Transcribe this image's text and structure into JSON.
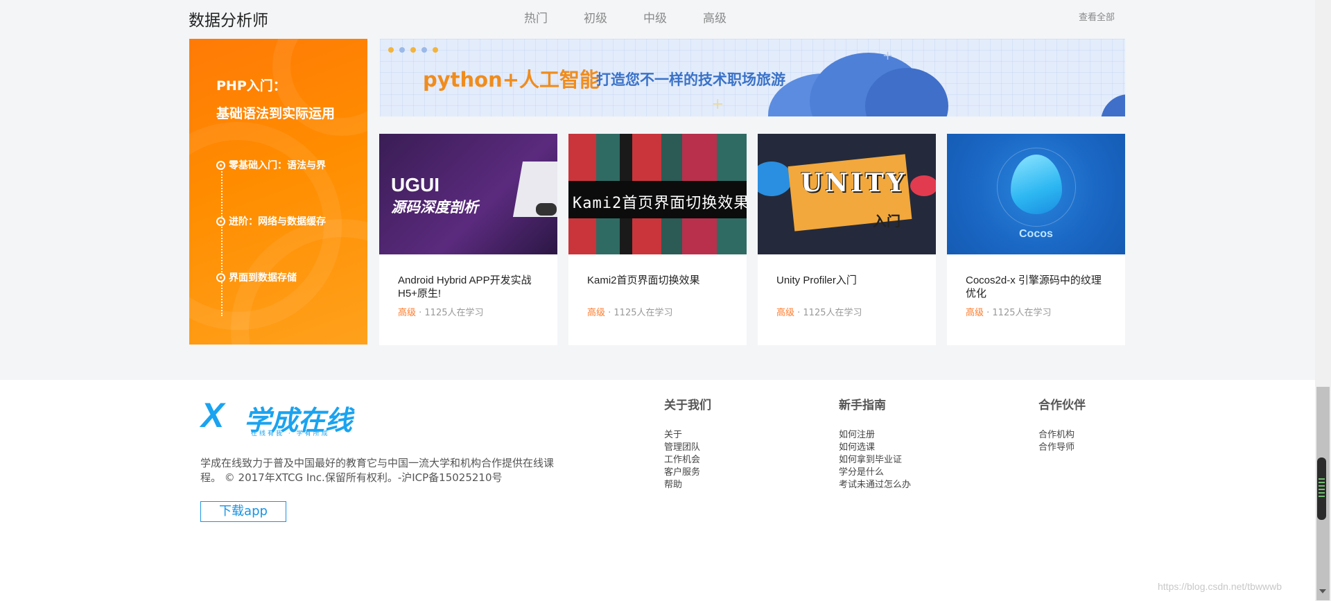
{
  "section": {
    "title": "数据分析师",
    "tabs": [
      "热门",
      "初级",
      "中级",
      "高级"
    ],
    "view_all": "查看全部"
  },
  "promo": {
    "title_line1": "PHP入门：",
    "title_line2": "基础语法到实际运用",
    "items": [
      "零基础入门：语法与界",
      "进阶：网络与数据缓存",
      "界面到数据存储"
    ]
  },
  "banner": {
    "main": "python+人工智能",
    "sub": "打造您不一样的技术职场旅游"
  },
  "courses": [
    {
      "thumb_line1": "UGUI",
      "thumb_line2": "源码深度剖析",
      "name": "Android Hybrid APP开发实战 H5+原生!",
      "level": "高级",
      "learners": " · 1125人在学习"
    },
    {
      "thumb_text": "Kami2首页界面切换效果",
      "name": "Kami2首页界面切换效果",
      "level": "高级",
      "learners": " · 1125人在学习"
    },
    {
      "thumb_text": "UNITY",
      "thumb_sub": "入门",
      "name": "Unity Profiler入门",
      "level": "高级",
      "learners": " · 1125人在学习"
    },
    {
      "thumb_text": "Cocos",
      "name": "Cocos2d-x 引擎源码中的纹理优化",
      "level": "高级",
      "learners": " · 1125人在学习"
    }
  ],
  "footer": {
    "logo_mark": "X",
    "logo_name": "学成在线",
    "logo_tag": "在线有我 · 学有所成",
    "desc": "学成在线致力于普及中国最好的教育它与中国一流大学和机构合作提供在线课程。 © 2017年XTCG Inc.保留所有权利。-沪ICP备15025210号",
    "download": "下载app",
    "columns": [
      {
        "title": "关于我们",
        "links": [
          "关于",
          "管理团队",
          "工作机会",
          "客户服务",
          "帮助"
        ]
      },
      {
        "title": "新手指南",
        "links": [
          "如何注册",
          "如何选课",
          "如何拿到毕业证",
          "学分是什么",
          "考试未通过怎么办"
        ]
      },
      {
        "title": "合作伙伴",
        "links": [
          "合作机构",
          "合作导师"
        ]
      }
    ]
  },
  "watermark": "https://blog.csdn.net/tbwwwb"
}
